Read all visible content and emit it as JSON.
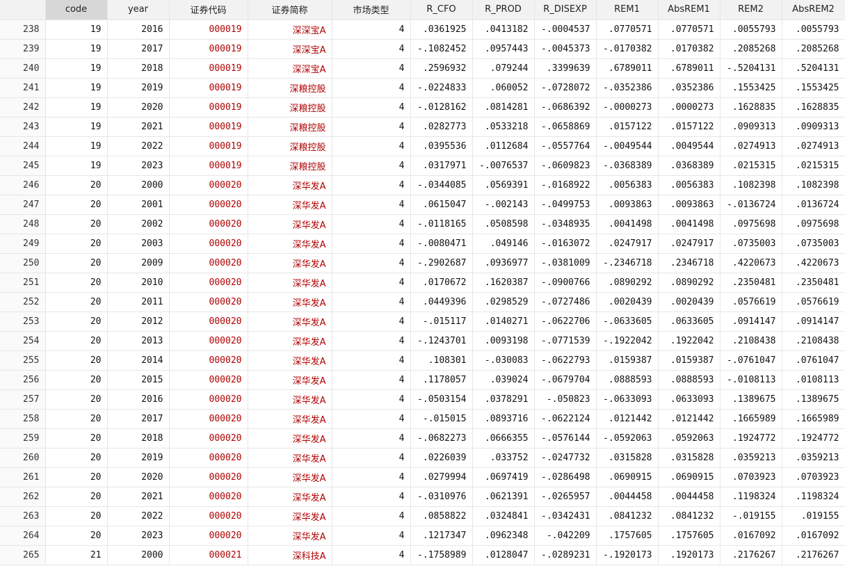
{
  "columns": [
    "",
    "code",
    "year",
    "证券代码",
    "证券简称",
    "市场类型",
    "R_CFO",
    "R_PROD",
    "R_DISEXP",
    "REM1",
    "AbsREM1",
    "REM2",
    "AbsREM2"
  ],
  "selected_column": "code",
  "rows": [
    [
      "238",
      "19",
      "2016",
      "000019",
      "深深宝A",
      "4",
      ".0361925",
      ".0413182",
      "-.0004537",
      ".0770571",
      ".0770571",
      ".0055793",
      ".0055793"
    ],
    [
      "239",
      "19",
      "2017",
      "000019",
      "深深宝A",
      "4",
      "-.1082452",
      ".0957443",
      "-.0045373",
      "-.0170382",
      ".0170382",
      ".2085268",
      ".2085268"
    ],
    [
      "240",
      "19",
      "2018",
      "000019",
      "深深宝A",
      "4",
      ".2596932",
      ".079244",
      ".3399639",
      ".6789011",
      ".6789011",
      "-.5204131",
      ".5204131"
    ],
    [
      "241",
      "19",
      "2019",
      "000019",
      "深粮控股",
      "4",
      "-.0224833",
      ".060052",
      "-.0728072",
      "-.0352386",
      ".0352386",
      ".1553425",
      ".1553425"
    ],
    [
      "242",
      "19",
      "2020",
      "000019",
      "深粮控股",
      "4",
      "-.0128162",
      ".0814281",
      "-.0686392",
      "-.0000273",
      ".0000273",
      ".1628835",
      ".1628835"
    ],
    [
      "243",
      "19",
      "2021",
      "000019",
      "深粮控股",
      "4",
      ".0282773",
      ".0533218",
      "-.0658869",
      ".0157122",
      ".0157122",
      ".0909313",
      ".0909313"
    ],
    [
      "244",
      "19",
      "2022",
      "000019",
      "深粮控股",
      "4",
      ".0395536",
      ".0112684",
      "-.0557764",
      "-.0049544",
      ".0049544",
      ".0274913",
      ".0274913"
    ],
    [
      "245",
      "19",
      "2023",
      "000019",
      "深粮控股",
      "4",
      ".0317971",
      "-.0076537",
      "-.0609823",
      "-.0368389",
      ".0368389",
      ".0215315",
      ".0215315"
    ],
    [
      "246",
      "20",
      "2000",
      "000020",
      "深华发A",
      "4",
      "-.0344085",
      ".0569391",
      "-.0168922",
      ".0056383",
      ".0056383",
      ".1082398",
      ".1082398"
    ],
    [
      "247",
      "20",
      "2001",
      "000020",
      "深华发A",
      "4",
      ".0615047",
      "-.002143",
      "-.0499753",
      ".0093863",
      ".0093863",
      "-.0136724",
      ".0136724"
    ],
    [
      "248",
      "20",
      "2002",
      "000020",
      "深华发A",
      "4",
      "-.0118165",
      ".0508598",
      "-.0348935",
      ".0041498",
      ".0041498",
      ".0975698",
      ".0975698"
    ],
    [
      "249",
      "20",
      "2003",
      "000020",
      "深华发A",
      "4",
      "-.0080471",
      ".049146",
      "-.0163072",
      ".0247917",
      ".0247917",
      ".0735003",
      ".0735003"
    ],
    [
      "250",
      "20",
      "2009",
      "000020",
      "深华发A",
      "4",
      "-.2902687",
      ".0936977",
      "-.0381009",
      "-.2346718",
      ".2346718",
      ".4220673",
      ".4220673"
    ],
    [
      "251",
      "20",
      "2010",
      "000020",
      "深华发A",
      "4",
      ".0170672",
      ".1620387",
      "-.0900766",
      ".0890292",
      ".0890292",
      ".2350481",
      ".2350481"
    ],
    [
      "252",
      "20",
      "2011",
      "000020",
      "深华发A",
      "4",
      ".0449396",
      ".0298529",
      "-.0727486",
      ".0020439",
      ".0020439",
      ".0576619",
      ".0576619"
    ],
    [
      "253",
      "20",
      "2012",
      "000020",
      "深华发A",
      "4",
      "-.015117",
      ".0140271",
      "-.0622706",
      "-.0633605",
      ".0633605",
      ".0914147",
      ".0914147"
    ],
    [
      "254",
      "20",
      "2013",
      "000020",
      "深华发A",
      "4",
      "-.1243701",
      ".0093198",
      "-.0771539",
      "-.1922042",
      ".1922042",
      ".2108438",
      ".2108438"
    ],
    [
      "255",
      "20",
      "2014",
      "000020",
      "深华发A",
      "4",
      ".108301",
      "-.030083",
      "-.0622793",
      ".0159387",
      ".0159387",
      "-.0761047",
      ".0761047"
    ],
    [
      "256",
      "20",
      "2015",
      "000020",
      "深华发A",
      "4",
      ".1178057",
      ".039024",
      "-.0679704",
      ".0888593",
      ".0888593",
      "-.0108113",
      ".0108113"
    ],
    [
      "257",
      "20",
      "2016",
      "000020",
      "深华发A",
      "4",
      "-.0503154",
      ".0378291",
      "-.050823",
      "-.0633093",
      ".0633093",
      ".1389675",
      ".1389675"
    ],
    [
      "258",
      "20",
      "2017",
      "000020",
      "深华发A",
      "4",
      "-.015015",
      ".0893716",
      "-.0622124",
      ".0121442",
      ".0121442",
      ".1665989",
      ".1665989"
    ],
    [
      "259",
      "20",
      "2018",
      "000020",
      "深华发A",
      "4",
      "-.0682273",
      ".0666355",
      "-.0576144",
      "-.0592063",
      ".0592063",
      ".1924772",
      ".1924772"
    ],
    [
      "260",
      "20",
      "2019",
      "000020",
      "深华发A",
      "4",
      ".0226039",
      ".033752",
      "-.0247732",
      ".0315828",
      ".0315828",
      ".0359213",
      ".0359213"
    ],
    [
      "261",
      "20",
      "2020",
      "000020",
      "深华发A",
      "4",
      ".0279994",
      ".0697419",
      "-.0286498",
      ".0690915",
      ".0690915",
      ".0703923",
      ".0703923"
    ],
    [
      "262",
      "20",
      "2021",
      "000020",
      "深华发A",
      "4",
      "-.0310976",
      ".0621391",
      "-.0265957",
      ".0044458",
      ".0044458",
      ".1198324",
      ".1198324"
    ],
    [
      "263",
      "20",
      "2022",
      "000020",
      "深华发A",
      "4",
      ".0858822",
      ".0324841",
      "-.0342431",
      ".0841232",
      ".0841232",
      "-.019155",
      ".019155"
    ],
    [
      "264",
      "20",
      "2023",
      "000020",
      "深华发A",
      "4",
      ".1217347",
      ".0962348",
      "-.042209",
      ".1757605",
      ".1757605",
      ".0167092",
      ".0167092"
    ],
    [
      "265",
      "21",
      "2000",
      "000021",
      "深科技A",
      "4",
      "-.1758989",
      ".0128047",
      "-.0289231",
      "-.1920173",
      ".1920173",
      ".2176267",
      ".2176267"
    ]
  ]
}
